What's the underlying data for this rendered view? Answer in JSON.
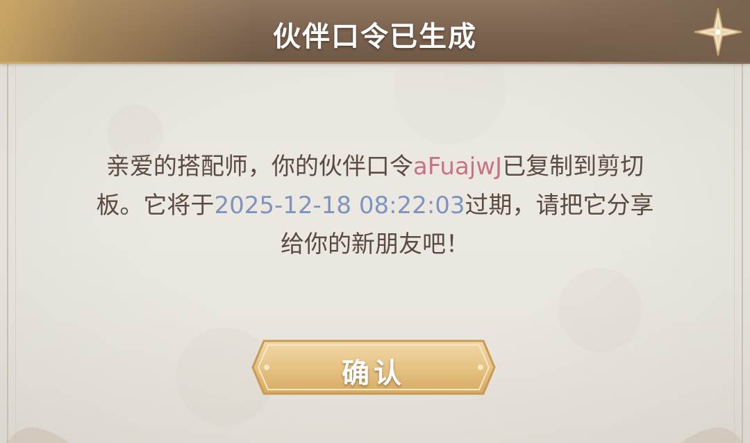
{
  "dialog": {
    "title": "伙伴口令已生成",
    "message": {
      "line1_prefix": "亲爱的搭配师，你的伙伴口令",
      "code": "aFuajwJ",
      "line1_suffix": "已复制到剪切",
      "line2_prefix": "板。它将于",
      "expiry": "2025-12-18 08:22:03",
      "line2_suffix": "过期，请把它分享",
      "line3": "给你的新朋友吧！"
    },
    "confirm_label": "确认"
  },
  "colors": {
    "code": "#c87382",
    "expiry": "#7e93bd",
    "text": "#5a4a3f",
    "header": "#7a624e"
  },
  "icons": {
    "corner_star": "four-point-star-icon"
  }
}
